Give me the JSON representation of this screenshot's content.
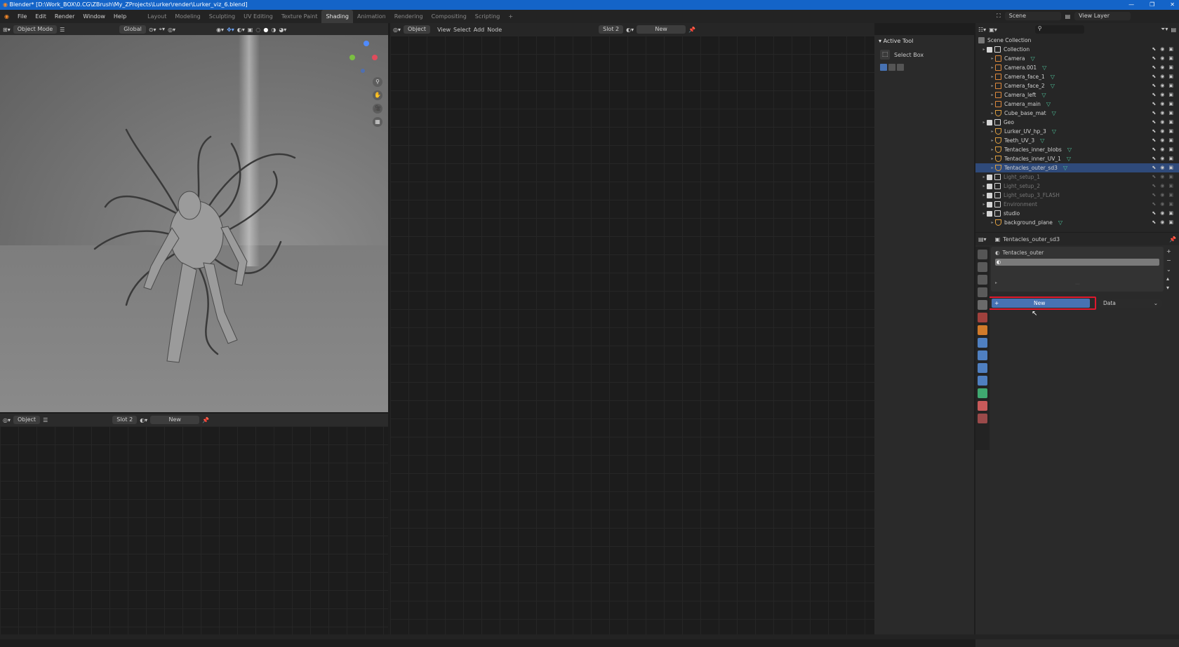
{
  "window": {
    "title": "Blender* [D:\\Work_BOX\\0.CG\\ZBrush\\My_ZProjects\\Lurker\\render\\Lurker_viz_6.blend]"
  },
  "menu": {
    "items": [
      "File",
      "Edit",
      "Render",
      "Window",
      "Help"
    ],
    "workspaces": [
      "Layout",
      "Modeling",
      "Sculpting",
      "UV Editing",
      "Texture Paint",
      "Shading",
      "Animation",
      "Rendering",
      "Compositing",
      "Scripting"
    ],
    "active_workspace": "Shading",
    "add_tab": "+",
    "scene": "Scene",
    "view_layer": "View Layer"
  },
  "viewport": {
    "mode": "Object Mode",
    "orientation": "Global"
  },
  "node_editor": {
    "object_dropdown": "Object",
    "menus": [
      "View",
      "Select",
      "Add",
      "Node"
    ],
    "slot": "Slot 2",
    "new_label": "New"
  },
  "lower_editor": {
    "object_dropdown": "Object",
    "slot": "Slot 2",
    "new_label": "New"
  },
  "active_tool": {
    "header": "Active Tool",
    "tool_name": "Select Box"
  },
  "outliner": {
    "root": "Scene Collection",
    "rows": [
      {
        "name": "Collection",
        "kind": "collection",
        "level": 0
      },
      {
        "name": "Camera",
        "kind": "camera",
        "level": 1
      },
      {
        "name": "Camera.001",
        "kind": "camera",
        "level": 1
      },
      {
        "name": "Camera_face_1",
        "kind": "camera",
        "level": 1
      },
      {
        "name": "Camera_face_2",
        "kind": "camera",
        "level": 1
      },
      {
        "name": "Camera_left",
        "kind": "camera",
        "level": 1
      },
      {
        "name": "Camera_main",
        "kind": "camera",
        "level": 1
      },
      {
        "name": "Cube_base_mat",
        "kind": "mesh",
        "level": 1
      },
      {
        "name": "Geo",
        "kind": "collection",
        "level": 0
      },
      {
        "name": "Lurker_UV_hp_3",
        "kind": "mesh",
        "level": 1
      },
      {
        "name": "Teeth_UV_3",
        "kind": "mesh",
        "level": 1
      },
      {
        "name": "Tentacles_inner_blobs",
        "kind": "mesh",
        "level": 1
      },
      {
        "name": "Tentacles_inner_UV_1",
        "kind": "mesh",
        "level": 1
      },
      {
        "name": "Tentacles_outer_sd3",
        "kind": "mesh",
        "level": 1,
        "selected": true
      },
      {
        "name": "Light_setup_1",
        "kind": "collection",
        "level": 0,
        "dim": true
      },
      {
        "name": "Light_setup_2",
        "kind": "collection",
        "level": 0,
        "dim": true
      },
      {
        "name": "Light_setup_3_FLASH",
        "kind": "collection",
        "level": 0,
        "dim": true
      },
      {
        "name": "Environment",
        "kind": "collection",
        "level": 0,
        "dim": true
      },
      {
        "name": "studio",
        "kind": "collection",
        "level": 0
      },
      {
        "name": "background_plane",
        "kind": "mesh",
        "level": 1
      }
    ]
  },
  "properties": {
    "object_name": "Tentacles_outer_sd3",
    "material_slot": "Tentacles_outer",
    "new_button": "New",
    "link_dropdown": "Data"
  },
  "colors": {
    "accent_blue": "#4772b3",
    "highlight_red": "#e0182d",
    "selected_row": "#2f4a7a",
    "titlebar": "#1464c8"
  }
}
